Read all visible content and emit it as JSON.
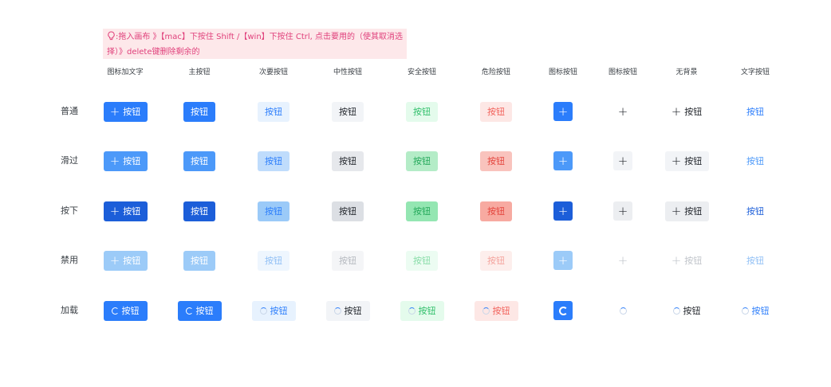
{
  "tip": {
    "text": ":拖入画布 》【mac】下按住 Shift /【win】下按住 Ctrl,  点击要用的（使其取消选择）》delete键删除剩余的"
  },
  "columns": [
    "图标加文字",
    "主按钮",
    "次要按钮",
    "中性按钮",
    "安全按钮",
    "危险按钮",
    "图标按钮",
    "图标按钮",
    "无背景",
    "文字按钮"
  ],
  "rows": [
    "普通",
    "滑过",
    "按下",
    "禁用",
    "加载"
  ],
  "button_label": "按钮",
  "colors": {
    "primary": "#2b7dfb",
    "primary_hover": "#4c99f9",
    "primary_active": "#1c5ed9",
    "primary_disabled": "#9ccbf8",
    "secondary_bg": "#e7f2fe",
    "neutral_bg": "#f2f4f7",
    "safe_text": "#2fbf6a",
    "danger_text": "#f2615a",
    "tip_text": "#e0407b"
  }
}
